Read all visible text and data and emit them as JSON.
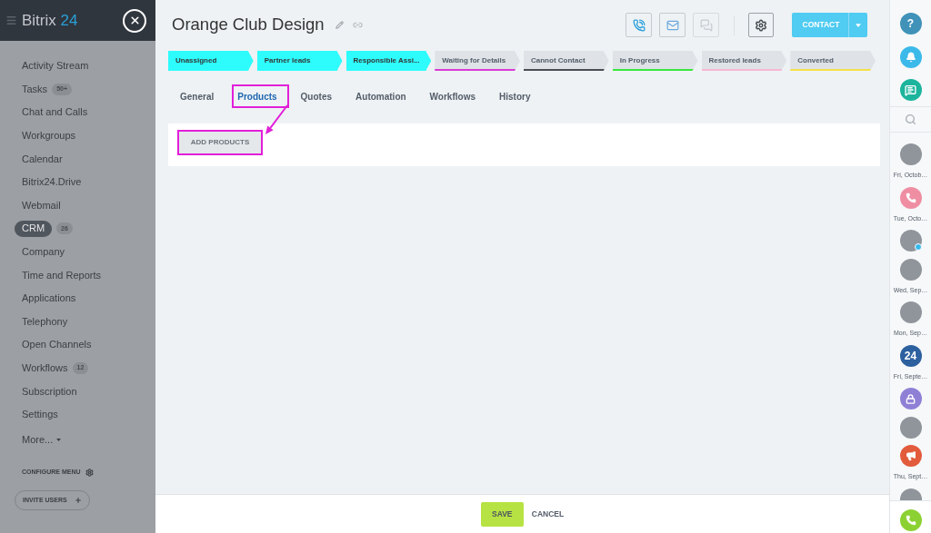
{
  "left_sidebar": {
    "logo": {
      "text": "Bitrix",
      "accent": "24"
    },
    "menu": [
      {
        "label": "Activity Stream",
        "kind": "link",
        "selected": false
      },
      {
        "label": "Tasks",
        "kind": "link",
        "counter": "50+",
        "selected": false
      },
      {
        "label": "Chat and Calls",
        "kind": "link",
        "selected": false
      },
      {
        "label": "Workgroups",
        "kind": "link",
        "selected": false
      },
      {
        "label": "Calendar",
        "kind": "link",
        "selected": false
      },
      {
        "label": "Bitrix24.Drive",
        "kind": "link",
        "selected": false
      },
      {
        "label": "Webmail",
        "kind": "link",
        "selected": false
      },
      {
        "label": "CRM",
        "kind": "link",
        "counter": "26",
        "selected": true
      },
      {
        "label": "Company",
        "kind": "link",
        "selected": false
      },
      {
        "label": "Time and Reports",
        "kind": "link",
        "selected": false
      },
      {
        "label": "Applications",
        "kind": "link",
        "selected": false
      },
      {
        "label": "Telephony",
        "kind": "link",
        "selected": false
      },
      {
        "label": "Open Channels",
        "kind": "link",
        "selected": false
      },
      {
        "label": "Workflows",
        "kind": "link",
        "counter": "12",
        "selected": false
      },
      {
        "label": "Subscription",
        "kind": "link",
        "selected": false
      },
      {
        "label": "Settings",
        "kind": "link",
        "selected": false
      },
      {
        "label": "More...",
        "kind": "more",
        "selected": false
      }
    ],
    "configure_menu": "CONFIGURE MENU",
    "invite_users": "INVITE USERS"
  },
  "header": {
    "title": "Orange Club Design",
    "actions": [
      {
        "kind": "call",
        "disabled": false
      },
      {
        "kind": "email",
        "disabled": false
      },
      {
        "kind": "chat",
        "disabled": true
      }
    ],
    "primary_button": "CONTACT"
  },
  "stages": [
    {
      "label": "Unassigned",
      "color": "#2efcfc",
      "reached": true
    },
    {
      "label": "Partner leads",
      "color": "#2efcfc",
      "reached": true
    },
    {
      "label": "Responsible Assi...",
      "color": "#2efcfc",
      "reached": true
    },
    {
      "label": "Waiting for Details",
      "color": "#d93cd6",
      "reached": false
    },
    {
      "label": "Cannot Contact",
      "color": "#4a4f55",
      "reached": false
    },
    {
      "label": "In Progress",
      "color": "#39e63c",
      "reached": false
    },
    {
      "label": "Restored leads",
      "color": "#f6b8d2",
      "reached": false
    },
    {
      "label": "Converted",
      "color": "#f6e04a",
      "reached": false
    }
  ],
  "tabs": [
    {
      "label": "General",
      "selected": false,
      "highlighted": false
    },
    {
      "label": "Products",
      "selected": true,
      "highlighted": true
    },
    {
      "label": "Quotes",
      "selected": false,
      "highlighted": false
    },
    {
      "label": "Automation",
      "selected": false,
      "highlighted": false
    },
    {
      "label": "Workflows",
      "selected": false,
      "highlighted": false
    },
    {
      "label": "History",
      "selected": false,
      "highlighted": false
    }
  ],
  "products_panel": {
    "add_button": {
      "label": "ADD PRODUCTS",
      "highlighted": true
    }
  },
  "footer": {
    "save": "SAVE",
    "cancel": "CANCEL"
  },
  "right_sidebar": {
    "help": "?",
    "recent": [
      {
        "kind": "photo",
        "badge": false,
        "caption": "Fri, Octob…"
      },
      {
        "kind": "call",
        "caption": "Tue, Octo…"
      },
      {
        "kind": "photo",
        "badge": true
      },
      {
        "kind": "photo",
        "badge": false,
        "caption": "Wed, Sep…"
      },
      {
        "kind": "photo",
        "badge": false,
        "caption": "Mon, Sep…"
      },
      {
        "kind": "logo",
        "label": "24",
        "caption": "Fri, Septe…"
      },
      {
        "kind": "lock"
      },
      {
        "kind": "photo",
        "badge": false
      },
      {
        "kind": "megaphone",
        "caption": "Thu, Sept…"
      },
      {
        "kind": "photo",
        "badge": false
      }
    ]
  }
}
